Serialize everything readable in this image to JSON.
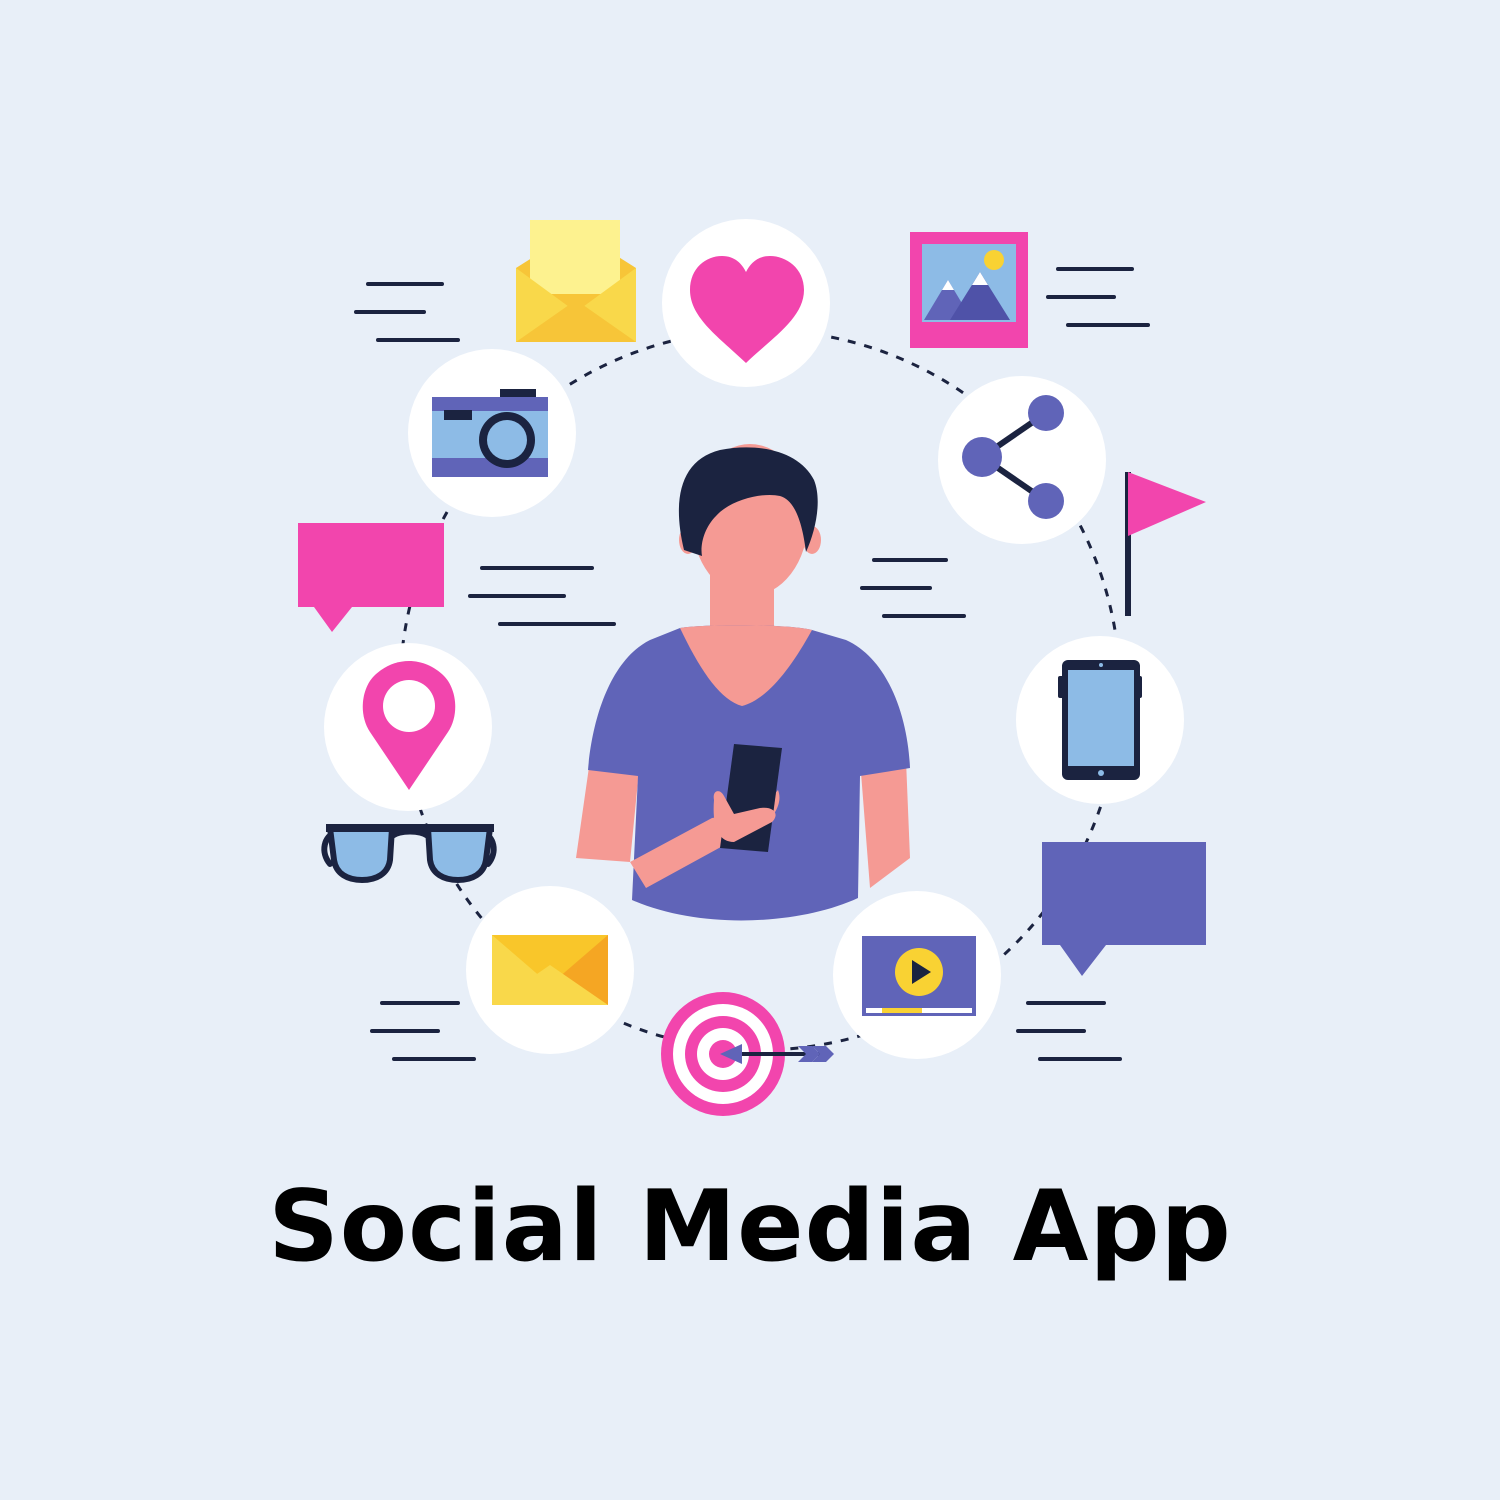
{
  "title": "Social Media App",
  "colors": {
    "background": "#E8EFF8",
    "navy": "#1B2340",
    "purple": "#6064B8",
    "pink": "#F245AD",
    "yellow": "#F9C62A",
    "light_blue": "#8DBBE6",
    "skin": "#F59A94"
  },
  "icons": [
    "heart-icon",
    "share-icon",
    "tablet-icon",
    "video-player-icon",
    "target-icon",
    "mail-envelope-icon",
    "glasses-icon",
    "location-pin-icon",
    "camera-icon",
    "open-letter-icon",
    "picture-frame-icon",
    "flag-icon",
    "pink-speech-bubble-icon",
    "purple-speech-bubble-icon"
  ]
}
